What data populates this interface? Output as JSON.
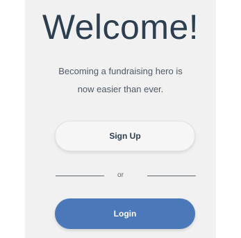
{
  "welcome": {
    "title": "Welcome!",
    "subtitle_line1": "Becoming a fundraising hero is",
    "subtitle_line2": "now easier than ever."
  },
  "buttons": {
    "signup_label": "Sign Up",
    "login_label": "Login"
  },
  "divider": {
    "text": "or"
  },
  "colors": {
    "background": "#f1f1f1",
    "title_text": "#2c3e4f",
    "primary": "#4a78b8",
    "secondary_button": "#f6f6f6"
  }
}
